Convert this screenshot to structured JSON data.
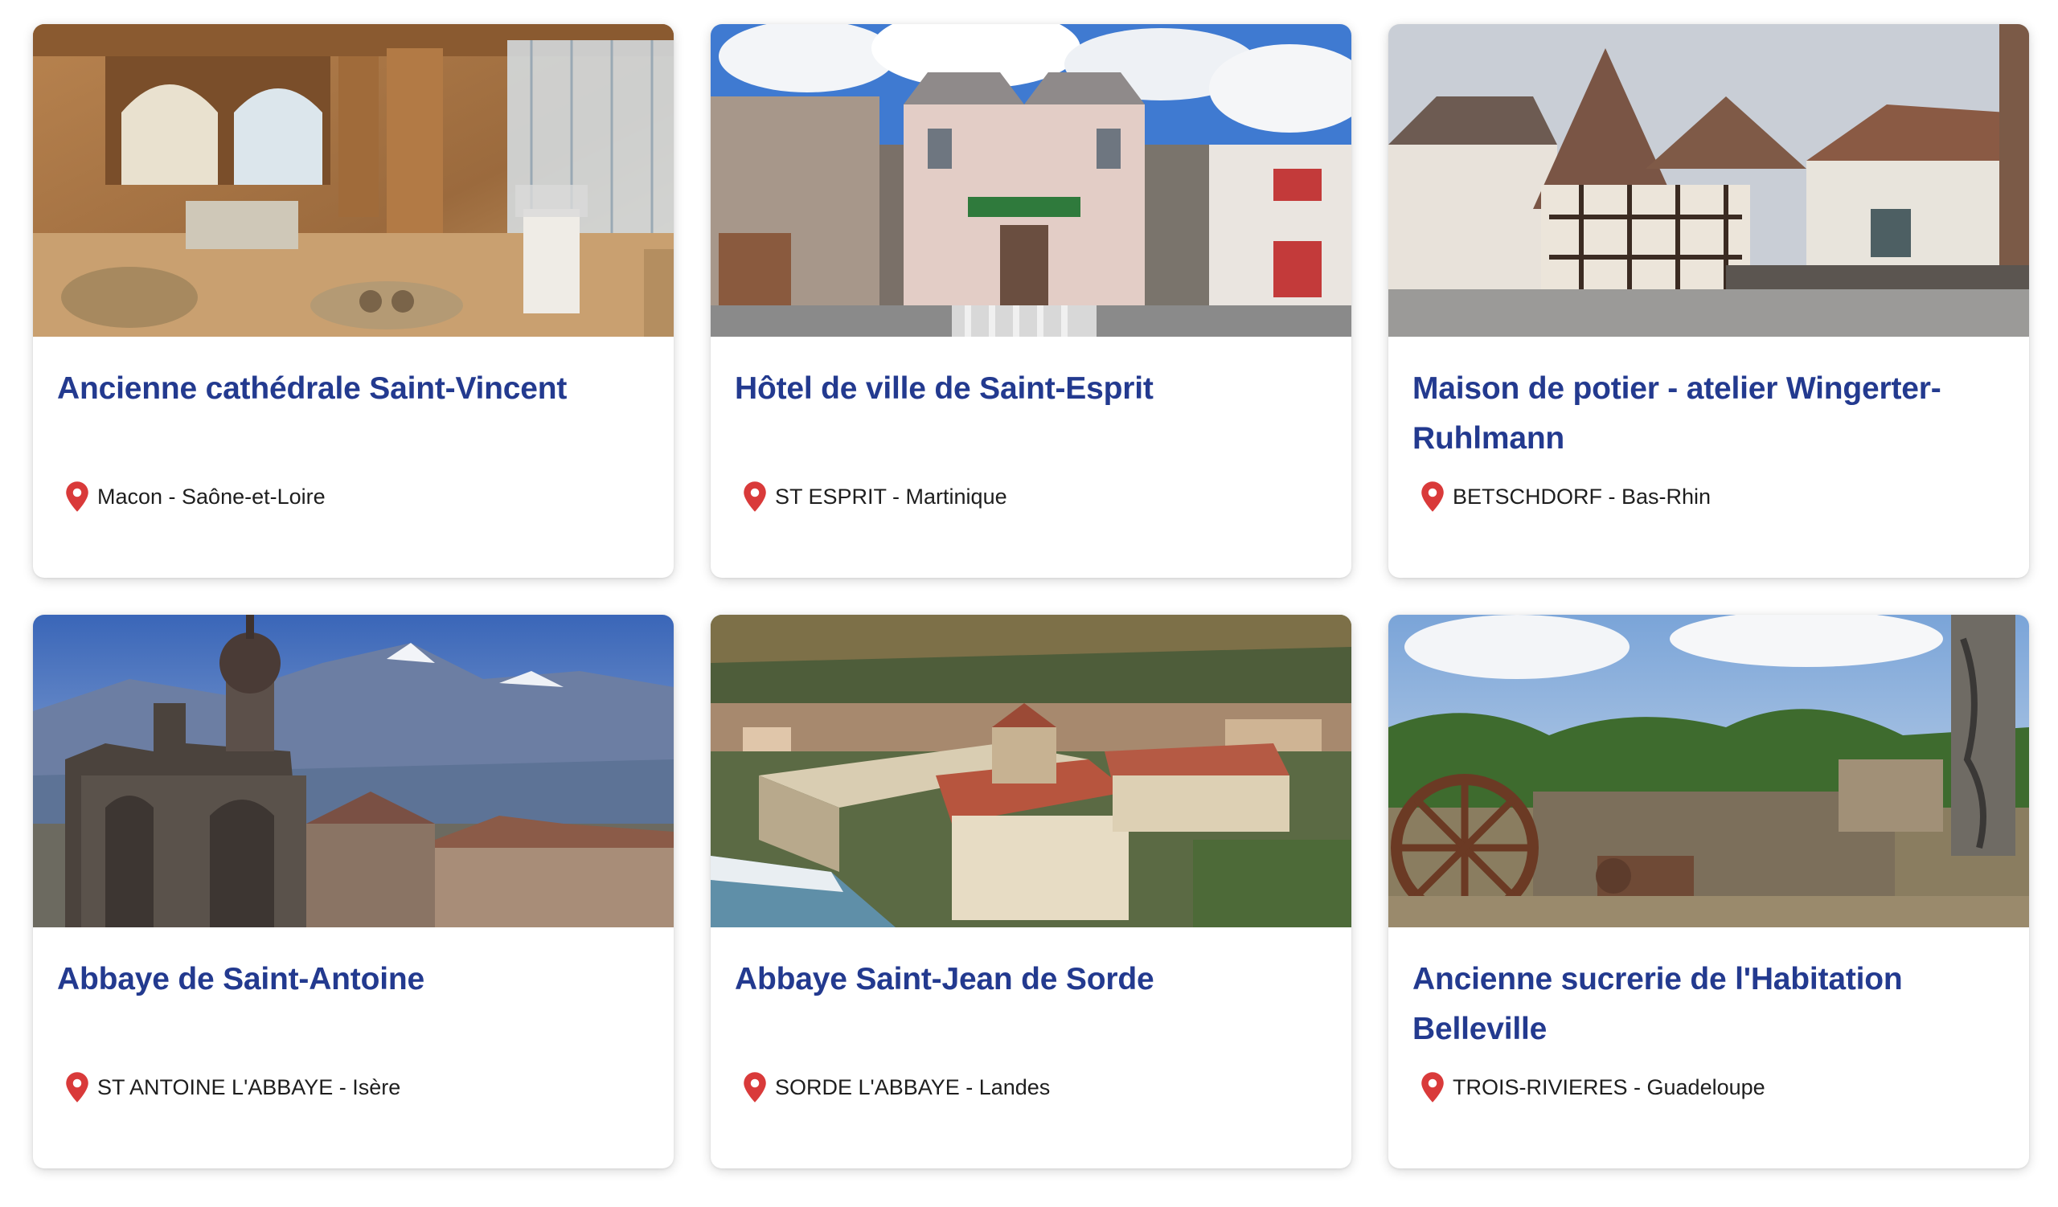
{
  "cards": [
    {
      "title": "Ancienne cathédrale Saint-Vincent",
      "location": "Macon - Saône-et-Loire",
      "image": "romanesque-chapel-interior-photo"
    },
    {
      "title": "Hôtel de ville de Saint-Esprit",
      "location": "ST ESPRIT - Martinique",
      "image": "town-hall-facade-photo"
    },
    {
      "title": "Maison de potier - atelier Wingerter-Ruhlmann",
      "location": "BETSCHDORF - Bas-Rhin",
      "image": "half-timbered-house-photo"
    },
    {
      "title": "Abbaye de Saint-Antoine",
      "location": "ST ANTOINE L'ABBAYE - Isère",
      "image": "gothic-abbey-mountains-photo"
    },
    {
      "title": "Abbaye Saint-Jean de Sorde",
      "location": "SORDE L'ABBAYE - Landes",
      "image": "aerial-abbey-village-photo"
    },
    {
      "title": "Ancienne sucrerie de l'Habitation Belleville",
      "location": "TROIS-RIVIERES - Guadeloupe",
      "image": "sugar-mill-ruins-photo"
    }
  ],
  "colors": {
    "title": "#233a8f",
    "pin": "#d93a3a",
    "text": "#1e1e1e"
  },
  "icons": {
    "location": "map-pin-icon"
  }
}
